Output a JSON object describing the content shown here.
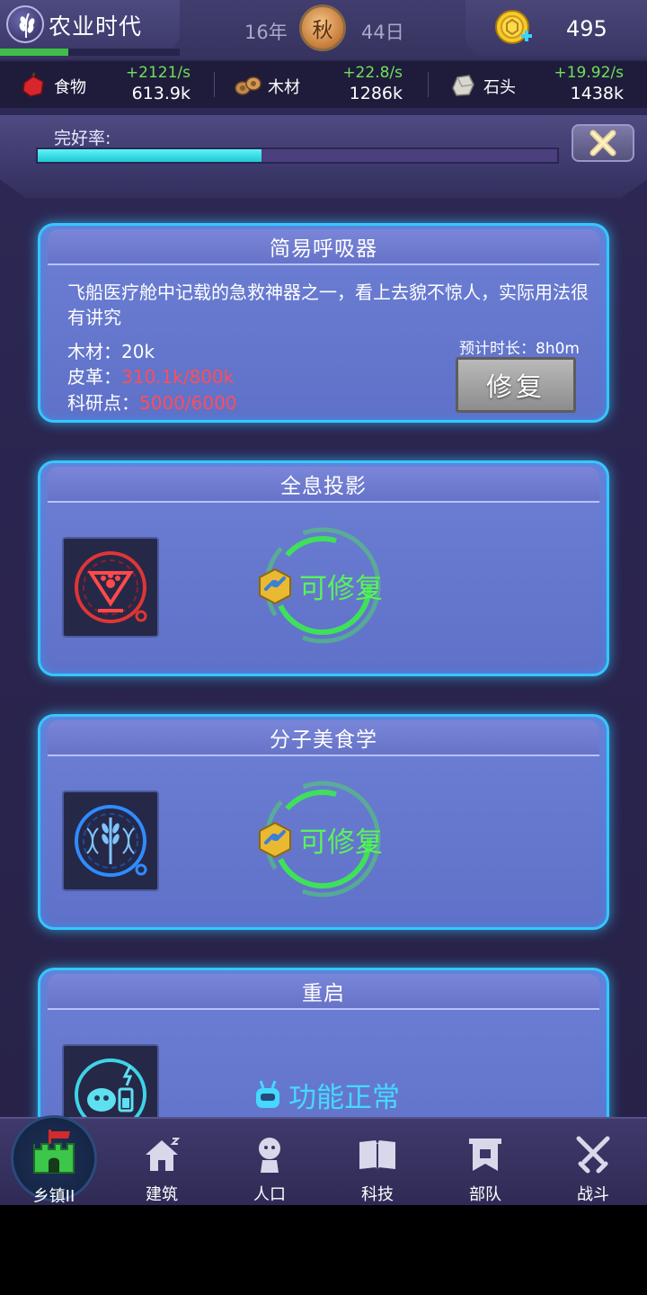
{
  "header": {
    "era_title": "农业时代",
    "era_progress": 0.38,
    "year": "16年",
    "season": "秋",
    "day": "44日",
    "gold": "495"
  },
  "resources": [
    {
      "name": "食物",
      "rate": "+2121/s",
      "amount": "613.9k",
      "icon": "meat-icon"
    },
    {
      "name": "木材",
      "rate": "+22.8/s",
      "amount": "1286k",
      "icon": "wood-icon"
    },
    {
      "name": "石头",
      "rate": "+19.92/s",
      "amount": "1438k",
      "icon": "stone-icon"
    }
  ],
  "integrity": {
    "label": "完好率:",
    "value": 0.43
  },
  "cards": [
    {
      "title": "简易呼吸器",
      "description": "飞船医疗舱中记载的急救神器之一，看上去貌不惊人，实际用法很有讲究",
      "requirements": [
        {
          "label": "木材：",
          "value": "20k",
          "ok": true
        },
        {
          "label": "皮革：",
          "value": "310.1k/800k",
          "ok": false
        },
        {
          "label": "科研点：",
          "value": "5000/6000",
          "ok": false
        }
      ],
      "eta": "预计时长：8h0m",
      "button": "修复"
    },
    {
      "title": "全息投影",
      "status": "可修复",
      "icon": "hologram-paw-icon"
    },
    {
      "title": "分子美食学",
      "status": "可修复",
      "icon": "wheat-dna-icon"
    },
    {
      "title": "重启",
      "status": "功能正常",
      "icon": "robot-battery-icon"
    }
  ],
  "nav": [
    {
      "label": "乡镇II",
      "icon": "castle-icon",
      "active": true
    },
    {
      "label": "建筑",
      "icon": "house-icon"
    },
    {
      "label": "人口",
      "icon": "person-icon"
    },
    {
      "label": "科技",
      "icon": "book-icon"
    },
    {
      "label": "部队",
      "icon": "banner-icon"
    },
    {
      "label": "战斗",
      "icon": "crossed-swords-icon"
    }
  ],
  "colors": {
    "card_border": "#35c7ff",
    "rate_green": "#6fe05a",
    "lacking_red": "#ff4d5a",
    "repairable_green": "#5af25a",
    "normal_cyan": "#45d9ff",
    "integrity_fill": "#1fc8d6"
  }
}
